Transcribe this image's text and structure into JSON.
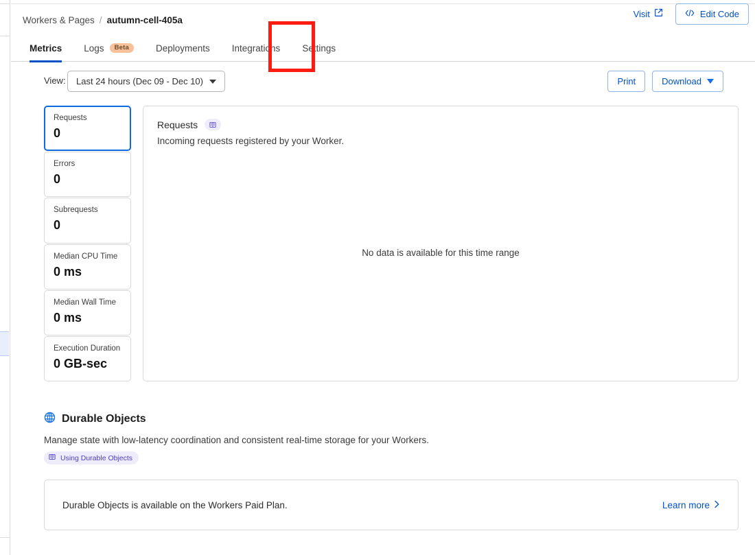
{
  "breadcrumb": {
    "parent": "Workers & Pages",
    "separator": "/",
    "current": "autumn-cell-405a"
  },
  "tabs": [
    {
      "label": "Metrics",
      "active": true,
      "badge": null
    },
    {
      "label": "Logs",
      "active": false,
      "badge": "Beta"
    },
    {
      "label": "Deployments",
      "active": false,
      "badge": null
    },
    {
      "label": "Integrations",
      "active": false,
      "badge": null
    },
    {
      "label": "Settings",
      "active": false,
      "badge": null
    }
  ],
  "header_actions": {
    "visit_label": "Visit",
    "visit_icon": "external-link-icon",
    "edit_code_label": "Edit Code",
    "edit_code_icon": "code-icon"
  },
  "toolbar": {
    "view_label": "View:",
    "view_value": "Last 24 hours (Dec 09 - Dec 10)",
    "print_label": "Print",
    "download_label": "Download"
  },
  "metrics": [
    {
      "name": "Requests",
      "value": "0",
      "selected": true
    },
    {
      "name": "Errors",
      "value": "0",
      "selected": false
    },
    {
      "name": "Subrequests",
      "value": "0",
      "selected": false
    },
    {
      "name": "Median CPU Time",
      "value": "0 ms",
      "selected": false
    },
    {
      "name": "Median Wall Time",
      "value": "0 ms",
      "selected": false
    },
    {
      "name": "Execution Duration",
      "value": "0 GB-sec",
      "selected": false
    }
  ],
  "chart_panel": {
    "title": "Requests",
    "docs_icon": "docs-book-icon",
    "description": "Incoming requests registered by your Worker.",
    "empty_message": "No data is available for this time range"
  },
  "durable_objects": {
    "icon": "globe-icon",
    "title": "Durable Objects",
    "description": "Manage state with low-latency coordination and consistent real-time storage for your Workers.",
    "badge_icon": "docs-book-icon",
    "badge_label": "Using Durable Objects",
    "card_text": "Durable Objects is available on the Workers Paid Plan.",
    "learn_more_label": "Learn more"
  },
  "annotation": {
    "target": "Settings",
    "color": "#fc1c12"
  },
  "colors": {
    "accent_blue": "#0051c3",
    "selected_border": "#0d6ae2",
    "beta_bg": "#f7c29a",
    "badge_purple_bg": "#eeebfa",
    "badge_purple_text": "#4d3fc0",
    "annotation_red": "#fc1c12"
  }
}
